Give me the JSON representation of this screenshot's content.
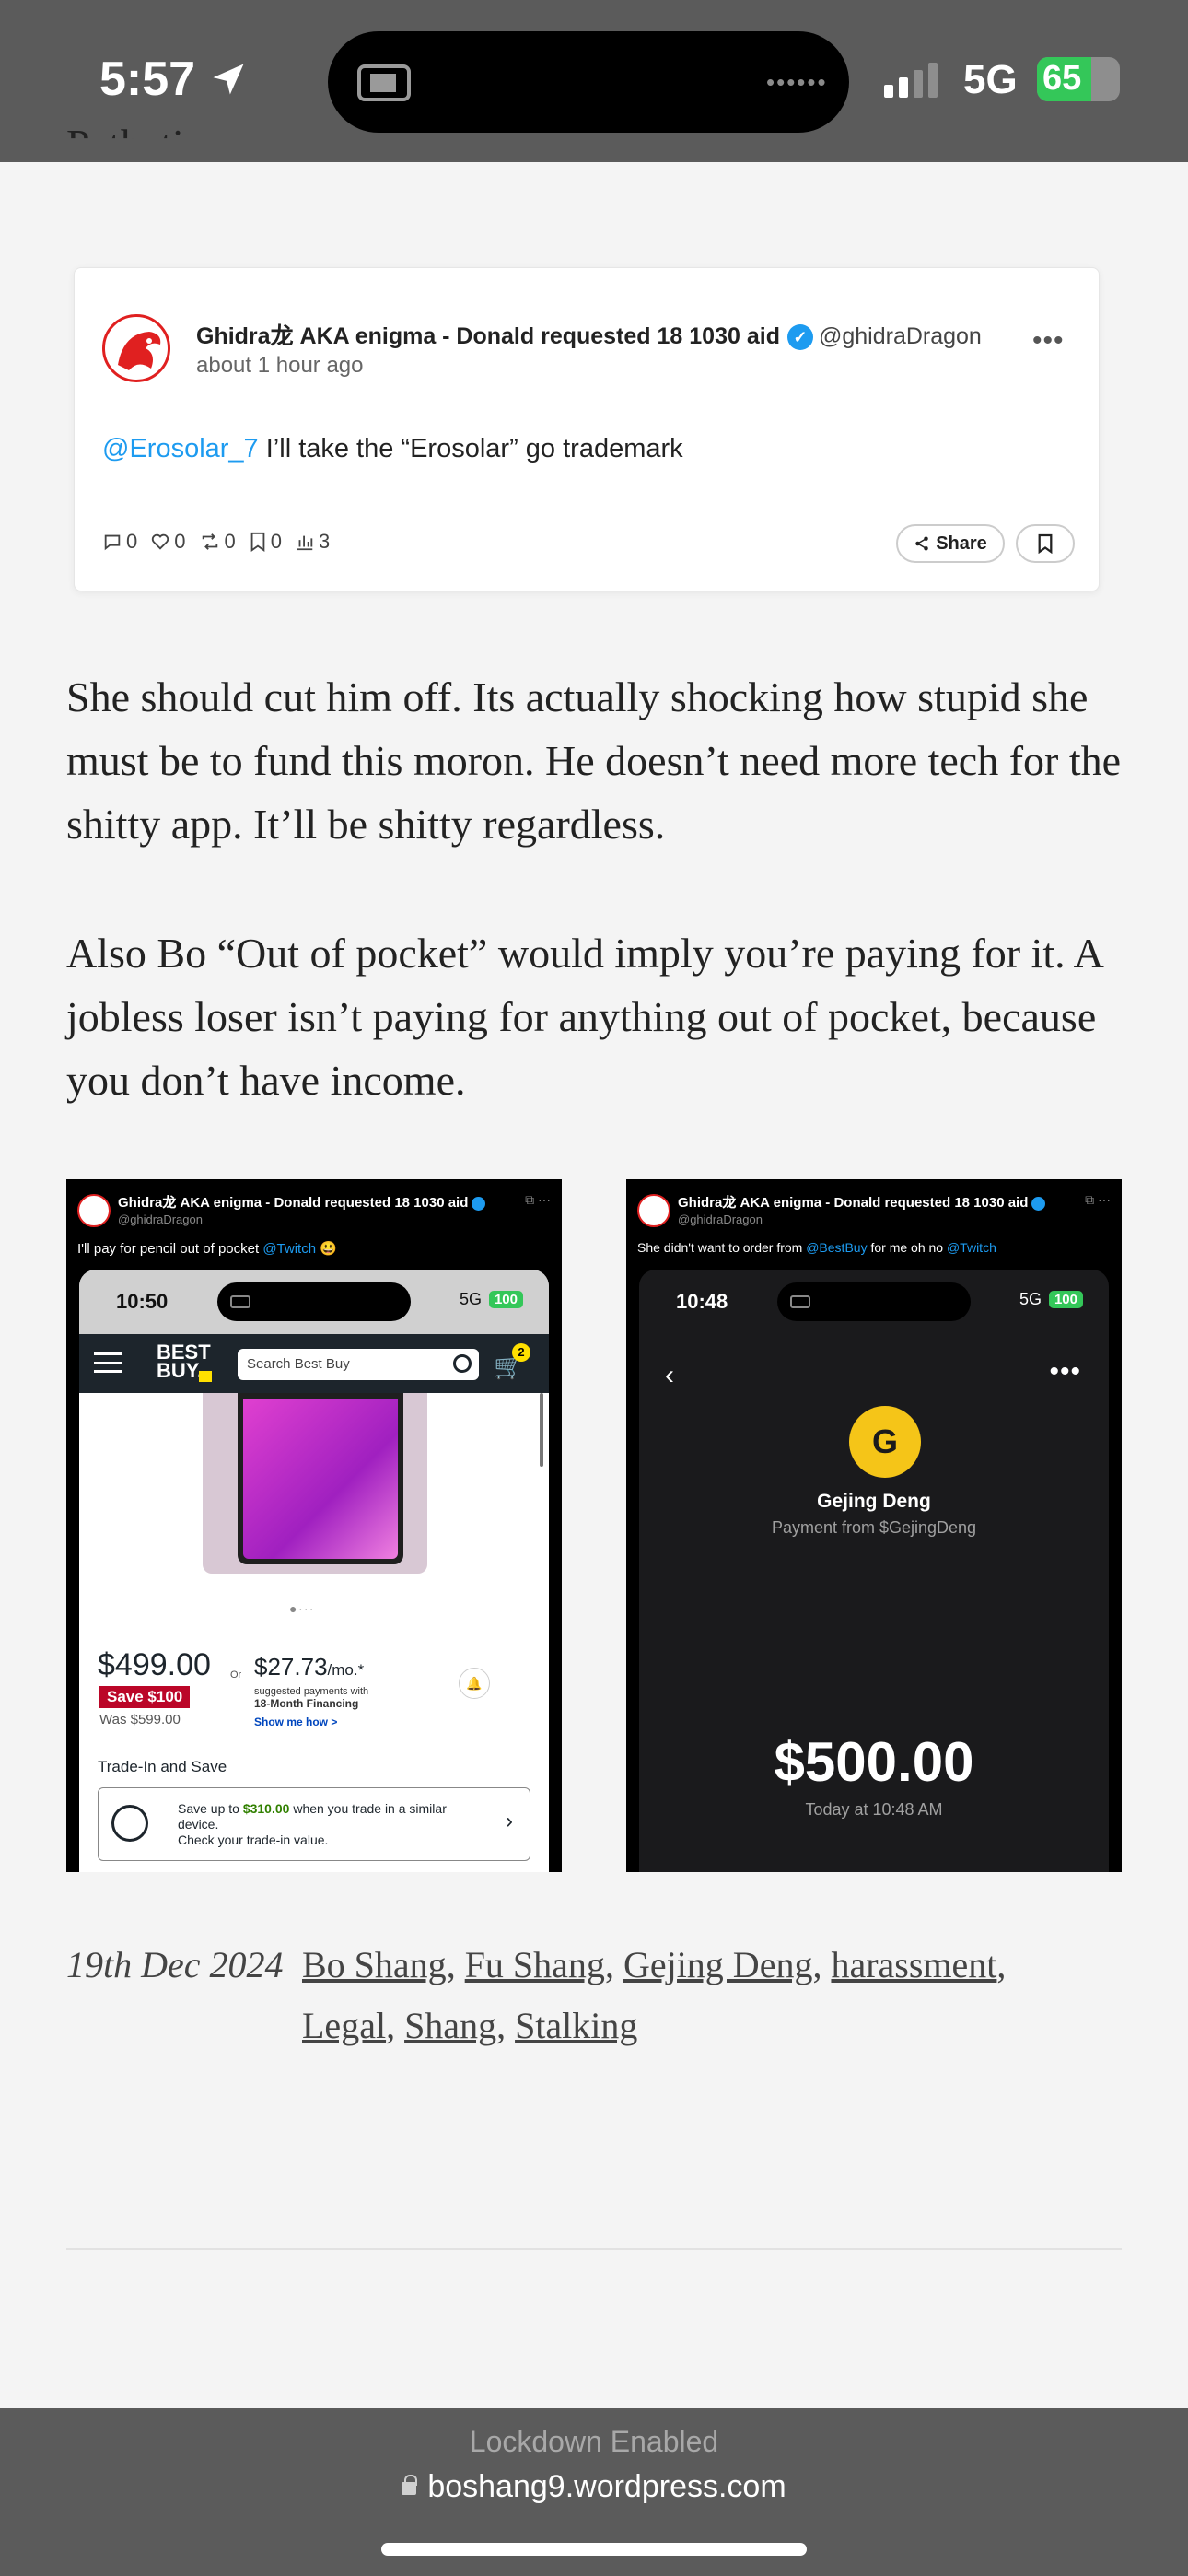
{
  "status_bar": {
    "time": "5:57",
    "network": "5G",
    "battery": "65",
    "battery_level": 0.65,
    "colors": {
      "bar_bg": "#5b5b5b",
      "battery_green": "#34c759"
    }
  },
  "article": {
    "cut_text": "Pathetic.",
    "embed": {
      "name": "Ghidra龙 AKA enigma - Donald requested 18 1030 aid",
      "handle": "@ghidraDragon",
      "time": "about 1 hour ago",
      "mention": "@Erosolar_7",
      "text": " I’ll take the “Erosolar” go trademark",
      "replies": "0",
      "likes": "0",
      "retweets": "0",
      "bookmarks": "0",
      "views": "3",
      "share_label": "Share",
      "more": "•••"
    },
    "para1": "She should cut him off. Its actually shocking how stupid she must be to fund this moron. He doesn’t need more tech for the shitty app. It’ll be shitty regardless.",
    "para2": "Also Bo “Out of pocket” would imply you’re paying for it. A jobless loser isn’t paying for anything out of pocket, because you don’t have income.",
    "images": [
      {
        "name": "Ghidra龙 AKA enigma - Donald requested 18 1030 aid",
        "handle": "@ghidraDragon",
        "text": "I'll pay for pencil out of pocket ",
        "mention": "@Twitch",
        "emoji": "😃",
        "phone_time": "10:50",
        "phone_net": "5G",
        "phone_batt": "100",
        "search_placeholder": "Search Best Buy",
        "cart_count": "2",
        "logo_top": "BEST",
        "logo_bottom": "BUY.",
        "price": "$499.00",
        "save": "Save $100",
        "was": "Was $599.00",
        "or": "Or",
        "monthly": "$27.73",
        "monthly_unit": "/mo.*",
        "fin_line1": "suggested payments with",
        "fin_line2": "18-Month Financing",
        "show_me": "Show me how >",
        "trade_title": "Trade-In and Save",
        "trade_pre": "Save up to ",
        "trade_amount": "$310.00",
        "trade_post": " when you trade in a similar device.",
        "trade_line2": "Check your trade-in value."
      },
      {
        "name": "Ghidra龙 AKA enigma - Donald requested 18 1030 aid",
        "handle": "@ghidraDragon",
        "text_pre": "She didn't want to order from ",
        "mention1": "@BestBuy",
        "text_mid": " for me oh no ",
        "mention2": "@Twitch",
        "phone_time": "10:48",
        "phone_net": "5G",
        "phone_batt": "100",
        "avatar_letter": "G",
        "payer_name": "Gejing Deng",
        "payer_sub": "Payment from $GejingDeng",
        "amount": "$500.00",
        "when": "Today at 10:48 AM"
      }
    ],
    "date": "19th Dec 2024",
    "tags": [
      "Bo Shang",
      "Fu Shang",
      "Gejing Deng",
      "harassment",
      "Legal",
      "Shang",
      "Stalking"
    ]
  },
  "bottom_bar": {
    "lockdown": "Lockdown Enabled",
    "url": "boshang9.wordpress.com"
  }
}
